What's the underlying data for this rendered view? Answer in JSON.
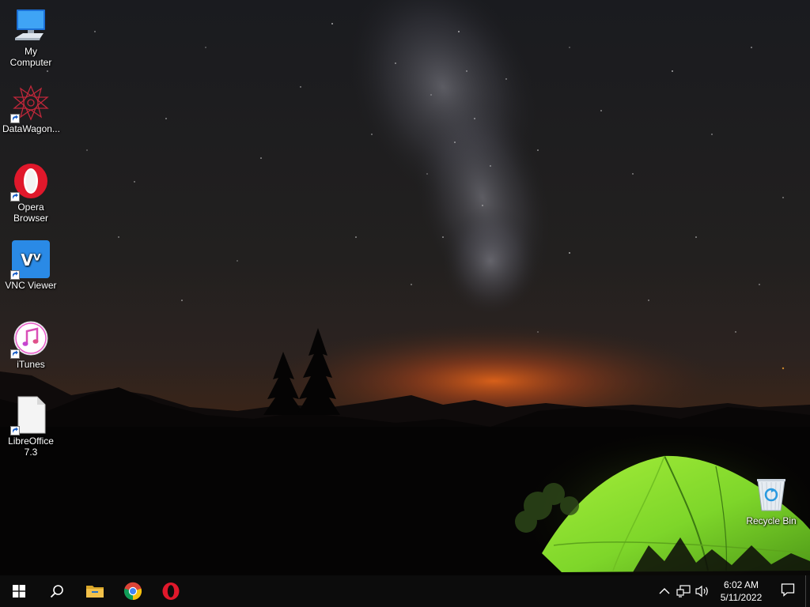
{
  "desktop": {
    "icons": [
      {
        "label": "My Computer",
        "icon": "monitor-icon"
      },
      {
        "label": "DataWagon...",
        "icon": "datawagon-icon"
      },
      {
        "label": "Opera Browser",
        "icon": "opera-icon"
      },
      {
        "label": "VNC Viewer",
        "icon": "vnc-icon"
      },
      {
        "label": "iTunes",
        "icon": "itunes-icon"
      },
      {
        "label": "LibreOffice 7.3",
        "icon": "document-icon"
      }
    ],
    "recycle_bin": {
      "label": "Recycle Bin",
      "icon": "recycle-bin-icon"
    }
  },
  "taskbar": {
    "pinned": [
      {
        "name": "start-button",
        "icon": "windows-logo-icon"
      },
      {
        "name": "search-button",
        "icon": "search-icon"
      },
      {
        "name": "file-explorer-button",
        "icon": "folder-icon"
      },
      {
        "name": "chrome-button",
        "icon": "chrome-icon"
      },
      {
        "name": "opera-button",
        "icon": "opera-icon"
      }
    ],
    "tray": {
      "icons": [
        "chevron-up-icon",
        "network-icon",
        "volume-icon"
      ],
      "time": "6:02 AM",
      "date": "5/11/2022",
      "notification_icon": "notification-icon"
    }
  },
  "colors": {
    "taskbar_bg": "#0c0c0c",
    "tent_green": "#7fd62a",
    "horizon_orange": "#e0631a",
    "opera_red": "#e0182b",
    "vnc_blue": "#2a8ae6",
    "folder_yellow": "#f2c14a"
  }
}
